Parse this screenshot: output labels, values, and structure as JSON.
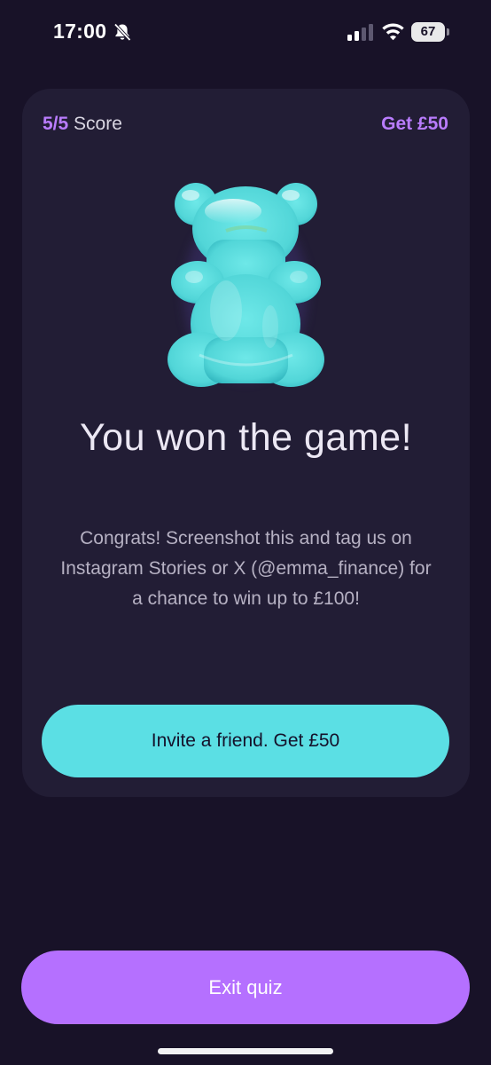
{
  "status_bar": {
    "time": "17:00",
    "battery_level": "67",
    "icons": [
      "bell-slash-icon",
      "cellular-signal-icon",
      "wifi-icon",
      "battery-icon"
    ]
  },
  "card": {
    "score_value": "5/5",
    "score_label": "Score",
    "reward_link": "Get £50",
    "illustration": "gummy-bear",
    "title": "You won the game!",
    "body": "Congrats! Screenshot this and tag us on Instagram Stories or X (@emma_finance) for a chance to win up to £100!",
    "invite_button": "Invite a friend. Get £50"
  },
  "footer": {
    "exit_button": "Exit quiz"
  },
  "colors": {
    "background": "#181228",
    "card": "#221d35",
    "accent_purple": "#b97cfd",
    "accent_cyan": "#5bdfe4",
    "exit_button": "#b570ff",
    "gummy_bear": "#6ee8e8"
  }
}
